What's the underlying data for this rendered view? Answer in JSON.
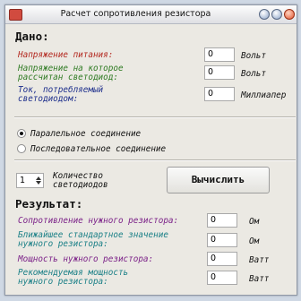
{
  "window": {
    "title": "Расчет сопротивления резистора"
  },
  "given": {
    "heading": "Дано:",
    "supply_voltage": {
      "label": "Напряжение питания:",
      "value": "0",
      "unit": "Вольт"
    },
    "led_voltage": {
      "label_line1": "Напряжение на которое",
      "label_line2": "рассчитан светодиод:",
      "value": "0",
      "unit": "Вольт"
    },
    "led_current": {
      "label_line1": "Ток, потребляемый",
      "label_line2": "светодиодом:",
      "value": "0",
      "unit": "Миллиапер"
    }
  },
  "connection": {
    "parallel": {
      "label": "Паралельное соединение",
      "selected": true
    },
    "series": {
      "label": "Последовательное соединение",
      "selected": false
    }
  },
  "count": {
    "value": "1",
    "label_line1": "Количество",
    "label_line2": "светодиодов"
  },
  "calculate_button": "Вычислить",
  "result": {
    "heading": "Результат:",
    "resistance": {
      "label": "Сопротивление нужного резистора:",
      "value": "0",
      "unit": "Ом"
    },
    "nearest_standard": {
      "label_line1": "Ближайшее стандартное значение",
      "label_line2": "нужного резистора:",
      "value": "0",
      "unit": "Ом"
    },
    "power": {
      "label": "Мощность нужного резистора:",
      "value": "0",
      "unit": "Ватт"
    },
    "recommended_power": {
      "label_line1": "Рекомендуемая мощность",
      "label_line2": "нужного резистора:",
      "value": "0",
      "unit": "Ватт"
    }
  },
  "colors": {
    "red_label": "#b3271e",
    "green_label": "#2f7b23",
    "blue_label": "#1e2f8c",
    "purple_label": "#7b2188",
    "teal_label": "#197f86"
  },
  "icons": {
    "app": "app-icon",
    "minimize": "minimize-icon",
    "maximize": "maximize-icon",
    "close": "close-icon"
  }
}
